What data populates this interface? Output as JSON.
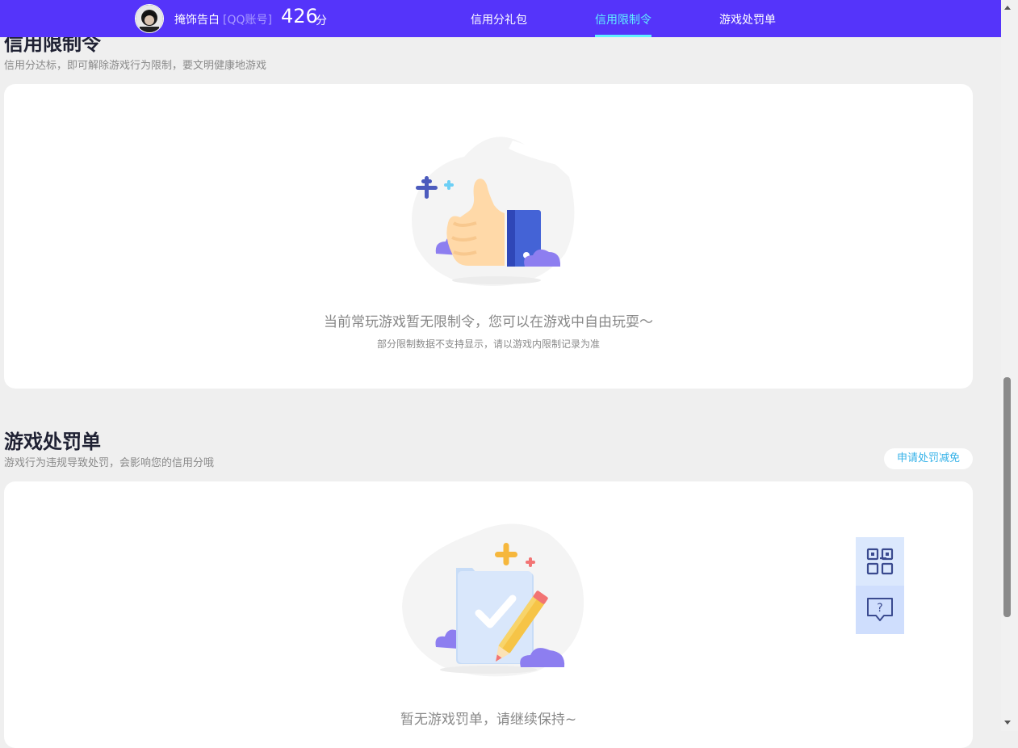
{
  "header": {
    "user_name": "掩饰告白",
    "account_type": "[QQ账号]",
    "score": "426",
    "score_unit": "分",
    "nav": [
      {
        "label": "信用分礼包",
        "active": false
      },
      {
        "label": "信用限制令",
        "active": true
      },
      {
        "label": "游戏处罚单",
        "active": false
      }
    ]
  },
  "restriction": {
    "title": "信用限制令",
    "subtitle": "信用分达标，即可解除游戏行为限制，要文明健康地游戏",
    "empty_main": "当前常玩游戏暂无限制令，您可以在游戏中自由玩耍～",
    "empty_sub": "部分限制数据不支持显示，请以游戏内限制记录为准",
    "illustration_icon": "thumbs-up-icon"
  },
  "penalty": {
    "title": "游戏处罚单",
    "subtitle": "游戏行为违规导致处罚，会影响您的信用分哦",
    "appeal_button": "申请处罚减免",
    "empty_main": "暂无游戏罚单，请继续保持~",
    "illustration_icon": "checklist-pencil-icon"
  },
  "side_buttons": [
    {
      "icon": "qr-code-icon"
    },
    {
      "icon": "help-chat-icon"
    }
  ],
  "colors": {
    "header_bg": "#5534fa",
    "nav_active": "#5ff0ff",
    "link": "#35b2e8",
    "page_bg": "#efefef"
  }
}
